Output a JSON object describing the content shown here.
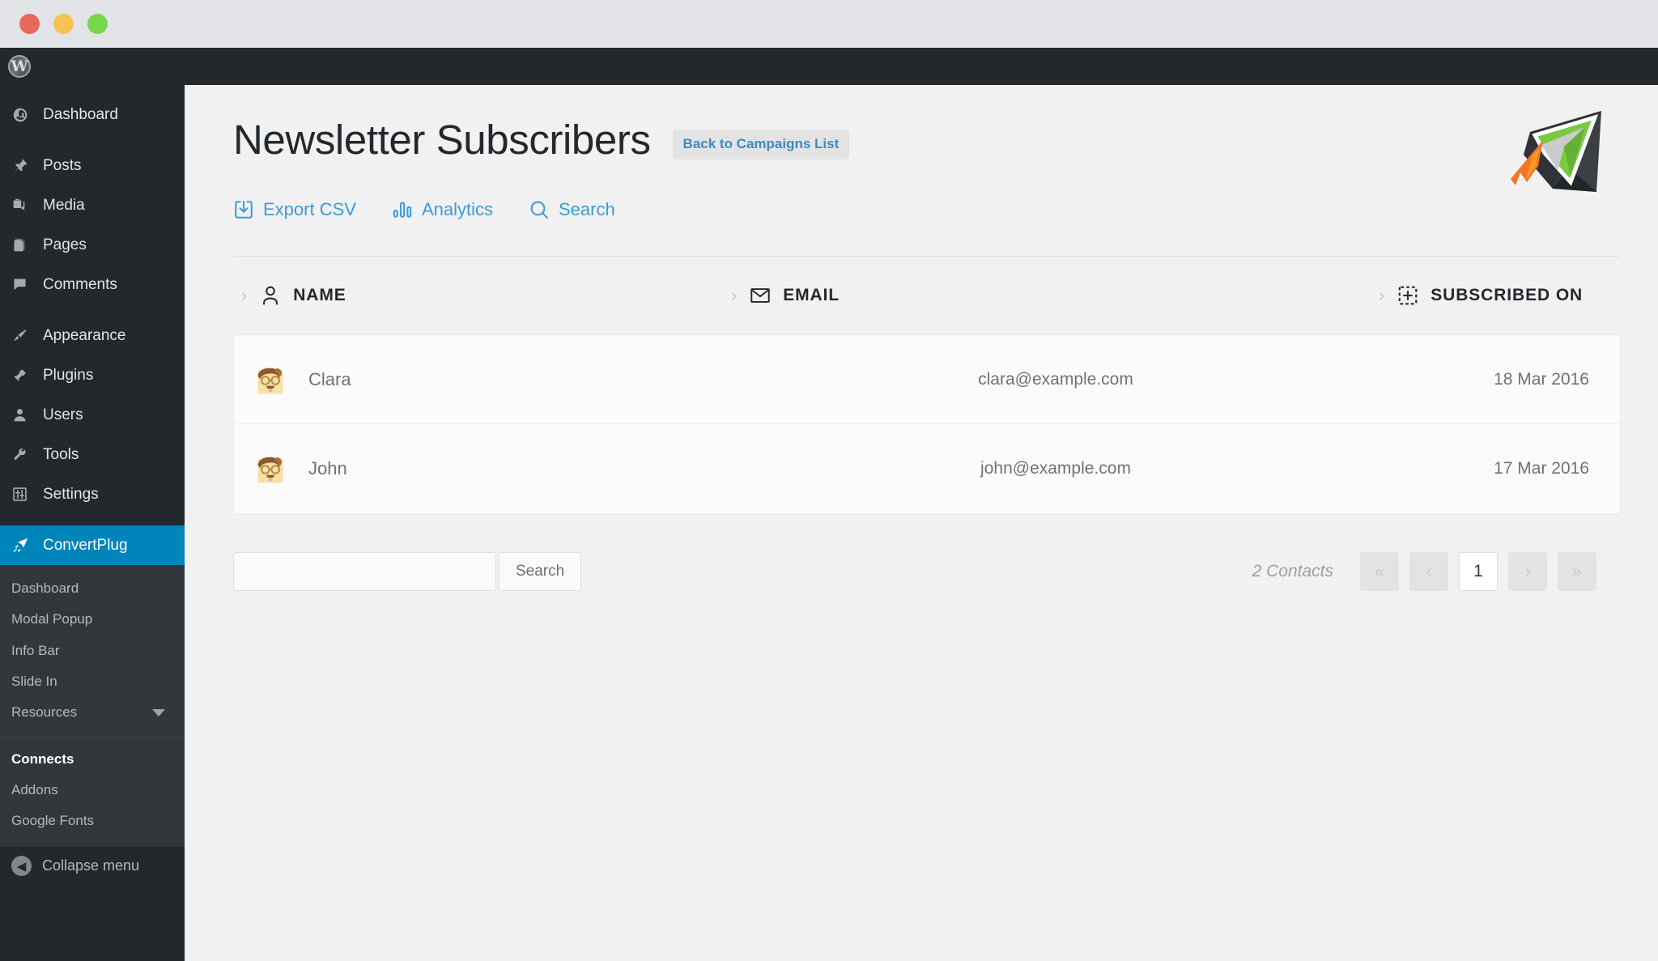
{
  "window": {
    "traffic_lights": [
      "close",
      "minimize",
      "maximize"
    ]
  },
  "adminbar": {
    "logo": "wordpress-logo",
    "logo_glyph": "W"
  },
  "sidebar": {
    "items": [
      {
        "label": "Dashboard",
        "icon": "dashboard-icon"
      },
      {
        "label": "Posts",
        "icon": "pin-icon"
      },
      {
        "label": "Media",
        "icon": "media-icon"
      },
      {
        "label": "Pages",
        "icon": "pages-icon"
      },
      {
        "label": "Comments",
        "icon": "comment-icon"
      },
      {
        "label": "Appearance",
        "icon": "brush-icon"
      },
      {
        "label": "Plugins",
        "icon": "plug-icon"
      },
      {
        "label": "Users",
        "icon": "user-icon"
      },
      {
        "label": "Tools",
        "icon": "wrench-icon"
      },
      {
        "label": "Settings",
        "icon": "sliders-icon"
      },
      {
        "label": "ConvertPlug",
        "icon": "convertplug-icon",
        "active": true
      }
    ],
    "submenu": [
      {
        "label": "Dashboard"
      },
      {
        "label": "Modal Popup"
      },
      {
        "label": "Info Bar"
      },
      {
        "label": "Slide In"
      },
      {
        "label": "Resources",
        "caret": "chevron-down-icon"
      },
      {
        "label": "Connects",
        "current": true
      },
      {
        "label": "Addons"
      },
      {
        "label": "Google Fonts"
      }
    ],
    "collapse": {
      "label": "Collapse menu",
      "icon": "collapse-left-icon"
    },
    "active_color": "#0085ba"
  },
  "header": {
    "title": "Newsletter Subscribers",
    "back_button": "Back to Campaigns List",
    "logo": "convertplug-rocket-logo"
  },
  "actions": [
    {
      "label": "Export CSV",
      "icon": "download-icon"
    },
    {
      "label": "Analytics",
      "icon": "bar-chart-icon"
    },
    {
      "label": "Search",
      "icon": "search-icon"
    }
  ],
  "table": {
    "columns": [
      {
        "label": "NAME",
        "icon": "person-icon"
      },
      {
        "label": "EMAIL",
        "icon": "envelope-icon"
      },
      {
        "label": "SUBSCRIBED ON",
        "icon": "dashed-plus-icon"
      }
    ],
    "rows": [
      {
        "avatar": "avatar-glasses",
        "name": "Clara",
        "email": "clara@example.com",
        "subscribed_on": "18 Mar 2016"
      },
      {
        "avatar": "avatar-glasses",
        "name": "John",
        "email": "john@example.com",
        "subscribed_on": "17 Mar 2016"
      }
    ]
  },
  "footer": {
    "search_value": "",
    "search_placeholder": "",
    "search_button": "Search",
    "contacts_count": "2 Contacts",
    "pagination": {
      "first": "«",
      "prev": "‹",
      "current": "1",
      "next": "›",
      "last": "»"
    }
  },
  "colors": {
    "accent": "#0085ba",
    "link": "#3d9bd6",
    "admin_dark": "#23282d",
    "submenu_dark": "#32373c",
    "content_bg": "#f1f1f1"
  }
}
